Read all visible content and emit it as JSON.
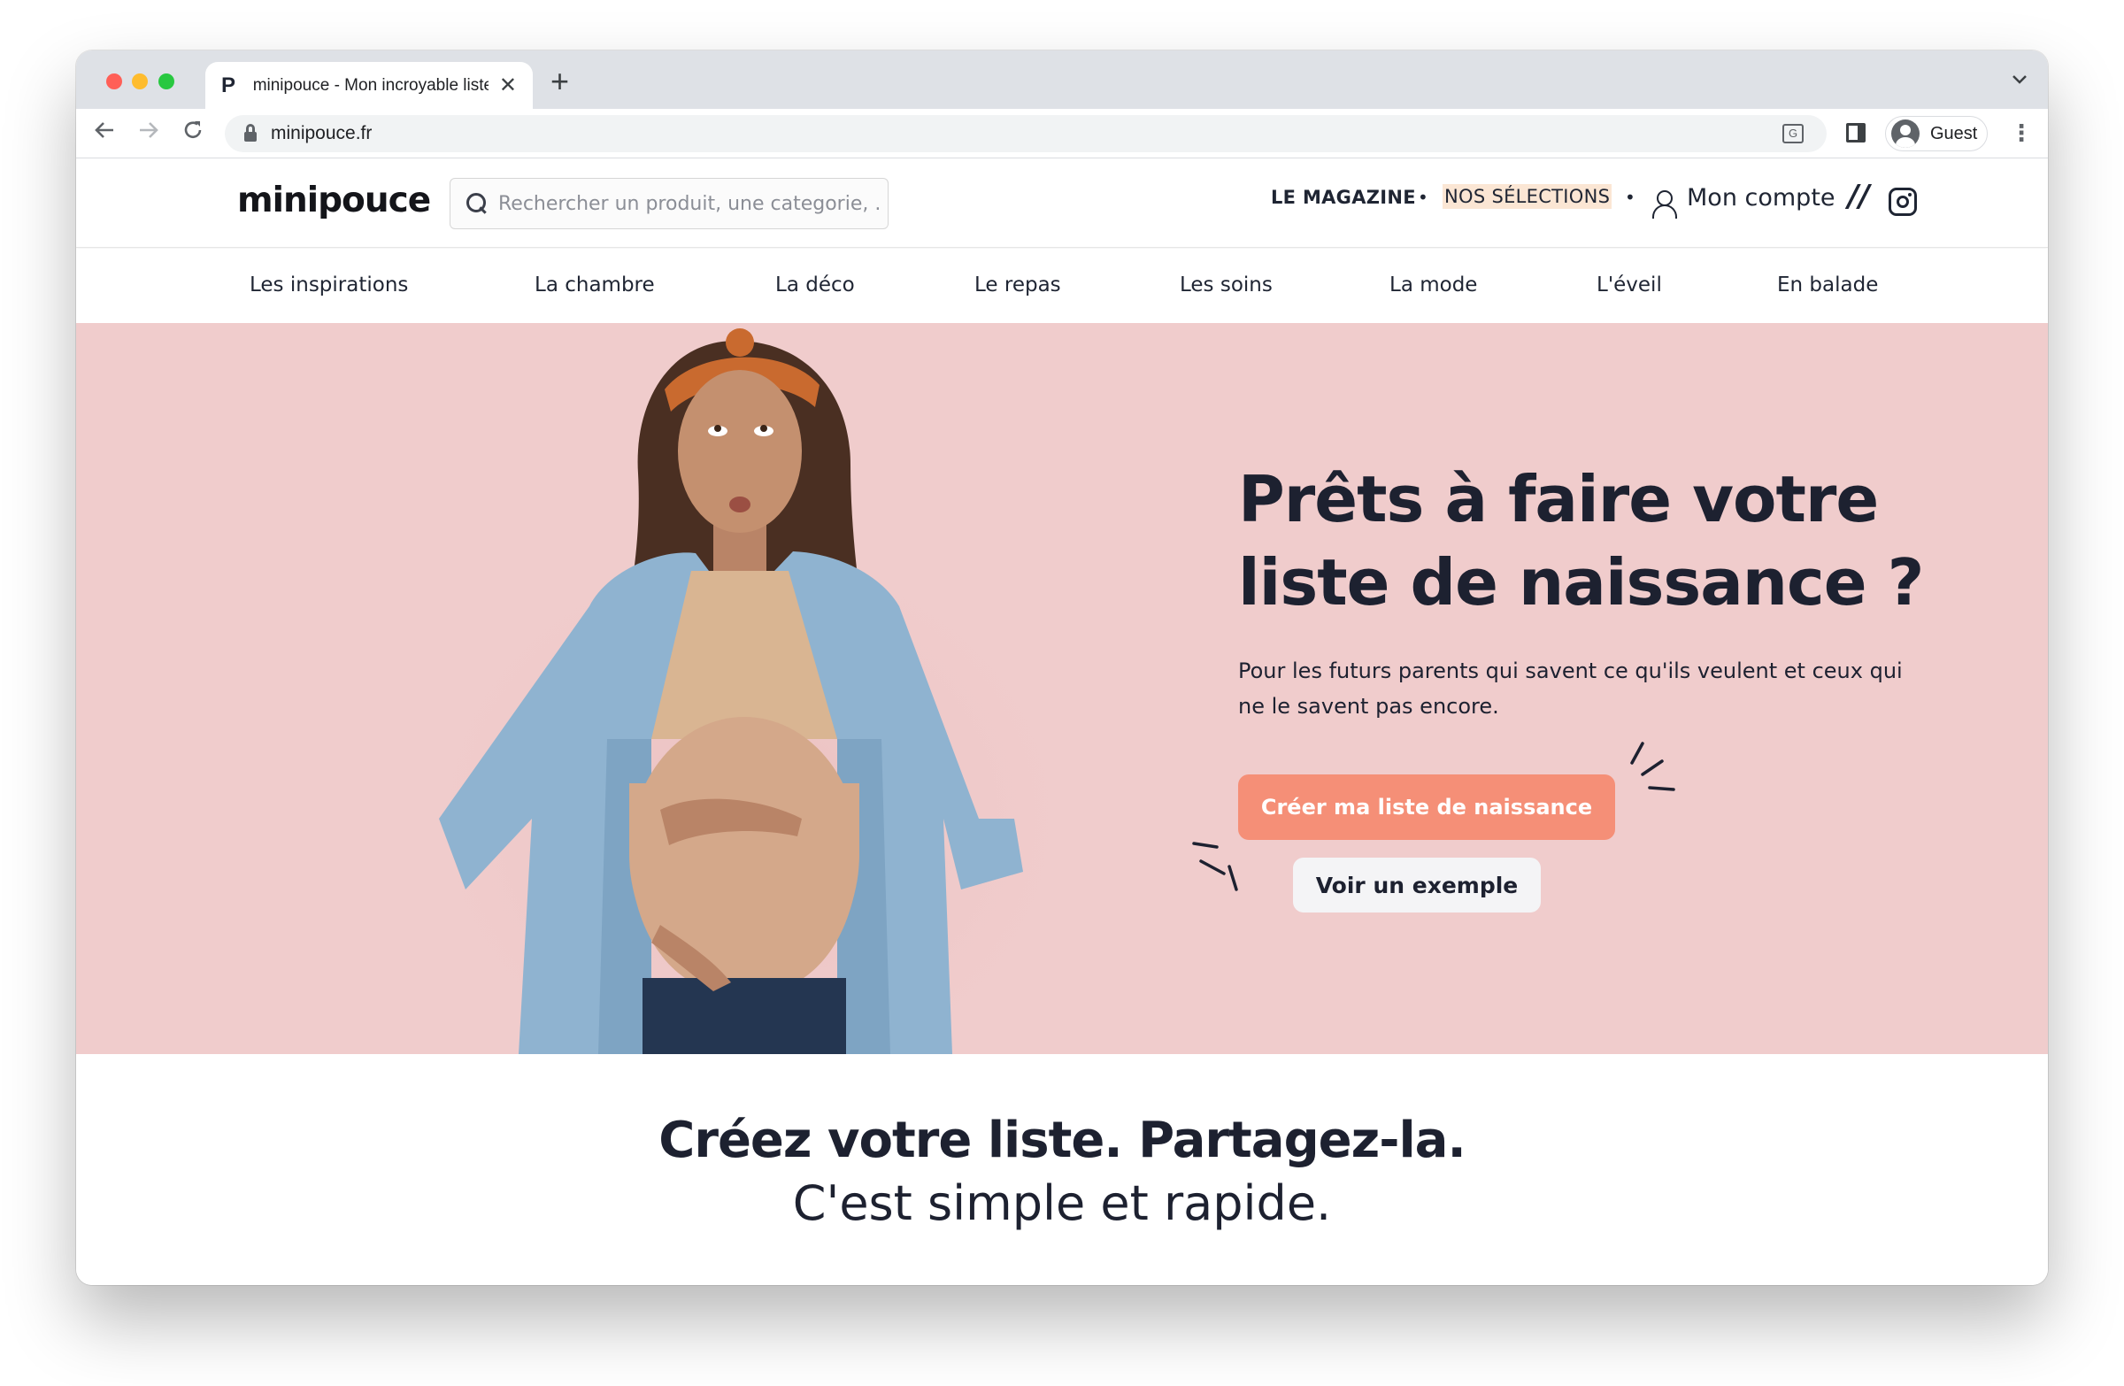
{
  "browser": {
    "tab_title": "minipouce - Mon incroyable liste",
    "tab_favicon": "P",
    "new_tab_symbol": "+",
    "close_symbol": "✕",
    "url": "minipouce.fr",
    "profile_label": "Guest"
  },
  "header": {
    "logo": "minipouce",
    "search_placeholder": "Rechercher un produit, une categorie, ..",
    "magazine": "LE MAGAZINE",
    "separator": "•",
    "selections": "NOS SÉLECTIONS",
    "account": "Mon compte",
    "slashes": "//"
  },
  "categories": [
    "Les inspirations",
    "La chambre",
    "La déco",
    "Le repas",
    "Les soins",
    "La mode",
    "L'éveil",
    "En balade"
  ],
  "hero": {
    "title_line1": "Prêts à faire votre",
    "title_line2": "liste de naissance ?",
    "subtitle": "Pour les futurs parents qui savent ce qu'ils veulent et ceux qui ne le savent pas encore.",
    "cta_label": "Créer ma liste de naissance",
    "secondary_label": "Voir un exemple",
    "background_color": "#f0cccc",
    "cta_color": "#f58f77"
  },
  "tagline": {
    "strong": "Créez votre liste. Partagez-la.",
    "light": "C'est simple et rapide."
  }
}
